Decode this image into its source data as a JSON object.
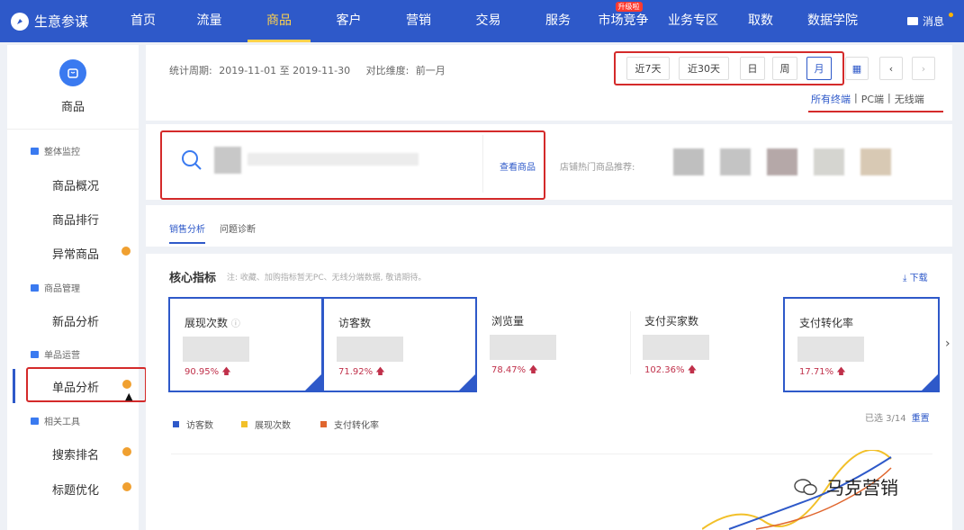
{
  "app": {
    "logo_text": "生意参谋",
    "nav": [
      "首页",
      "流量",
      "商品",
      "客户",
      "营销",
      "交易",
      "服务",
      "市场竞争",
      "业务专区",
      "取数",
      "数据学院"
    ],
    "nav_active": "商品",
    "nav_badge": "升级啦",
    "message": "消息"
  },
  "sidebar": {
    "title": "商品",
    "sections": [
      "整体监控",
      "商品管理",
      "单品运营",
      "相关工具"
    ],
    "items": [
      "商品概况",
      "商品排行",
      "异常商品",
      "新品分析",
      "单品分析",
      "搜索排名",
      "标题优化"
    ],
    "active_item": "单品分析"
  },
  "period": {
    "label": "统计周期:",
    "range": "2019-11-01 至 2019-11-30",
    "compare_label": "对比维度:",
    "compare_value": "前一月"
  },
  "range_buttons": [
    "近7天",
    "近30天",
    "日",
    "周",
    "月"
  ],
  "range_selected": "月",
  "terminals": [
    "所有终端",
    "PC端",
    "无线端"
  ],
  "terminal_selected": "所有终端",
  "search": {
    "view_link": "查看商品",
    "hot_label": "店铺热门商品推荐:"
  },
  "tabs": [
    "销售分析",
    "问题诊断"
  ],
  "metrics": {
    "title": "核心指标",
    "note": "注: 收藏、加购指标暂无PC、无线分端数据, 敬请期待。",
    "download": "下载",
    "items": [
      {
        "label": "展现次数",
        "change": "90.95%",
        "selected": true
      },
      {
        "label": "访客数",
        "change": "71.92%",
        "selected": true
      },
      {
        "label": "浏览量",
        "change": "78.47%",
        "selected": false
      },
      {
        "label": "支付买家数",
        "change": "102.36%",
        "selected": false
      },
      {
        "label": "支付转化率",
        "change": "17.71%",
        "selected": true
      }
    ]
  },
  "legend": [
    {
      "label": "访客数",
      "color": "#2e59c9"
    },
    {
      "label": "展现次数",
      "color": "#f2c029"
    },
    {
      "label": "支付转化率",
      "color": "#e0662e"
    }
  ],
  "selected_count": "已选 3/14",
  "reset": "重置",
  "watermark": "马克营销"
}
